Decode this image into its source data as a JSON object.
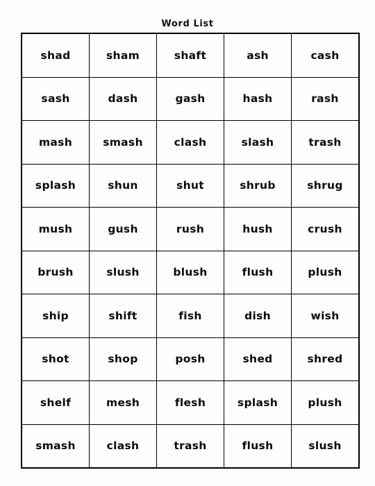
{
  "page": {
    "title": "Word List",
    "background_color": "#fdfdfd",
    "border_color": "#000000",
    "text_color": "#0a0a0a"
  },
  "table": {
    "columns": 5,
    "rows_count": 10,
    "rows": [
      [
        "shad",
        "sham",
        "shaft",
        "ash",
        "cash"
      ],
      [
        "sash",
        "dash",
        "gash",
        "hash",
        "rash"
      ],
      [
        "mash",
        "smash",
        "clash",
        "slash",
        "trash"
      ],
      [
        "splash",
        "shun",
        "shut",
        "shrub",
        "shrug"
      ],
      [
        "mush",
        "gush",
        "rush",
        "hush",
        "crush"
      ],
      [
        "brush",
        "slush",
        "blush",
        "flush",
        "plush"
      ],
      [
        "ship",
        "shift",
        "fish",
        "dish",
        "wish"
      ],
      [
        "shot",
        "shop",
        "posh",
        "shed",
        "shred"
      ],
      [
        "shelf",
        "mesh",
        "flesh",
        "splash",
        "plush"
      ],
      [
        "smash",
        "clash",
        "trash",
        "flush",
        "slush"
      ]
    ]
  }
}
